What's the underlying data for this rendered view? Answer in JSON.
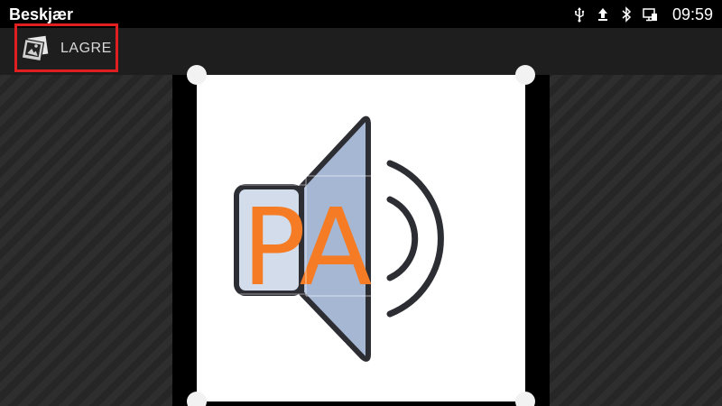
{
  "status_bar": {
    "title": "Beskjær",
    "time": "09:59",
    "icons": [
      "usb-icon",
      "upload-icon",
      "bluetooth-icon",
      "screen-cast-icon"
    ]
  },
  "toolbar": {
    "save_label": "LAGRE",
    "save_icon": "picture-icon",
    "highlight_color": "#e02020"
  },
  "image": {
    "text": "PA",
    "text_color": "#f57c24",
    "speaker_fill": "#a6b7d4",
    "box_fill": "#d3dcea",
    "outline_color": "#2d2d34"
  },
  "colors": {
    "background": "#000000",
    "action_bar": "#1e1e1e",
    "handle": "#f2f2f2"
  }
}
